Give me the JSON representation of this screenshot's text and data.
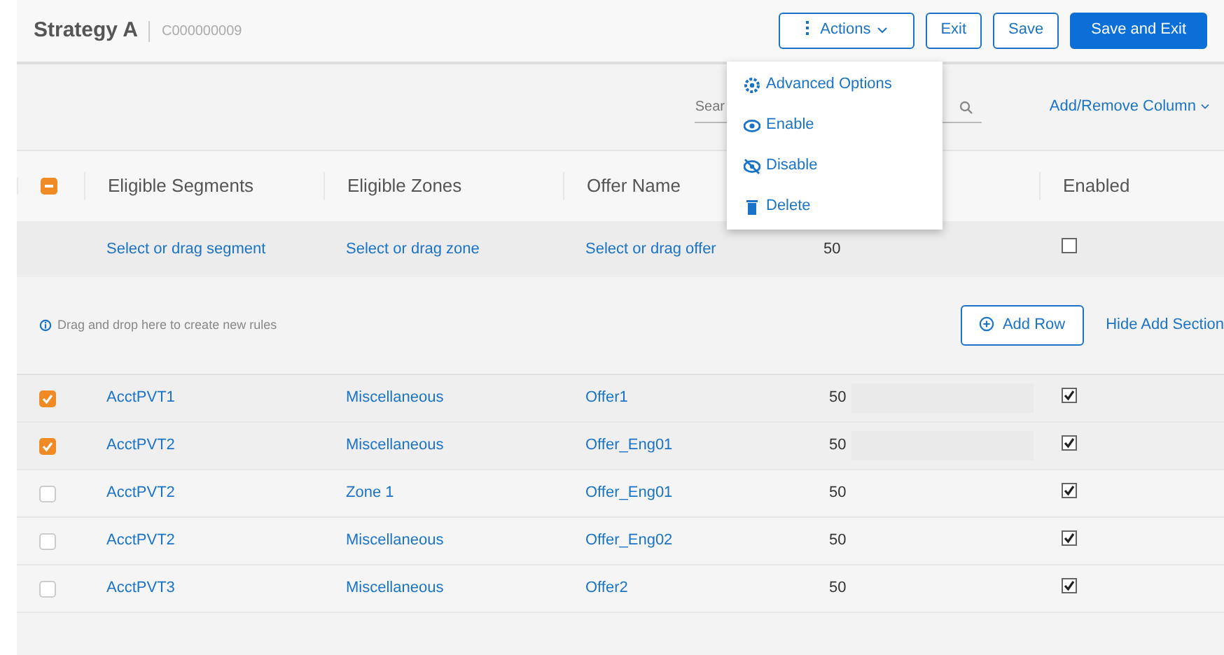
{
  "header": {
    "title": "Strategy A",
    "code": "C000000009"
  },
  "buttons": [
    {
      "label": "Actions",
      "kind": "menu",
      "expanded": true
    },
    {
      "label": "Exit",
      "kind": "outline"
    },
    {
      "label": "Save",
      "kind": "outline"
    },
    {
      "label": "Save and Exit",
      "kind": "primary"
    }
  ],
  "actions_menu": [
    {
      "label": "Advanced Options"
    },
    {
      "label": "Enable"
    },
    {
      "label": "Disable"
    },
    {
      "label": "Delete"
    }
  ],
  "search": {
    "placeholder": "Sear"
  },
  "column_picker": "Add/Remove Column",
  "table": {
    "select_all": {
      "indeterminate": true
    },
    "columns": [
      "Eligible Segments",
      "Eligible Zones",
      "Offer Name",
      "Enabled"
    ],
    "add_row": {
      "segment": "Select or drag segment",
      "zone": "Select or drag zone",
      "offer": "Select or drag offer",
      "value": "50",
      "enabled": false
    },
    "drop_hint": "Drag and drop here to create new rules",
    "add_button": "Add Row",
    "hide_link": "Hide Add Section",
    "rows": [
      {
        "selected": true,
        "segment": "AcctPVT1",
        "zone": "Miscellaneous",
        "offer": "Offer1",
        "value": "50",
        "enabled": true
      },
      {
        "selected": true,
        "segment": "AcctPVT2",
        "zone": "Miscellaneous",
        "offer": "Offer_Eng01",
        "value": "50",
        "enabled": true
      },
      {
        "selected": false,
        "segment": "AcctPVT2",
        "zone": "Zone 1",
        "offer": "Offer_Eng01",
        "value": "50",
        "enabled": true
      },
      {
        "selected": false,
        "segment": "AcctPVT2",
        "zone": "Miscellaneous",
        "offer": "Offer_Eng02",
        "value": "50",
        "enabled": true
      },
      {
        "selected": false,
        "segment": "AcctPVT3",
        "zone": "Miscellaneous",
        "offer": "Offer2",
        "value": "50",
        "enabled": true
      }
    ]
  }
}
